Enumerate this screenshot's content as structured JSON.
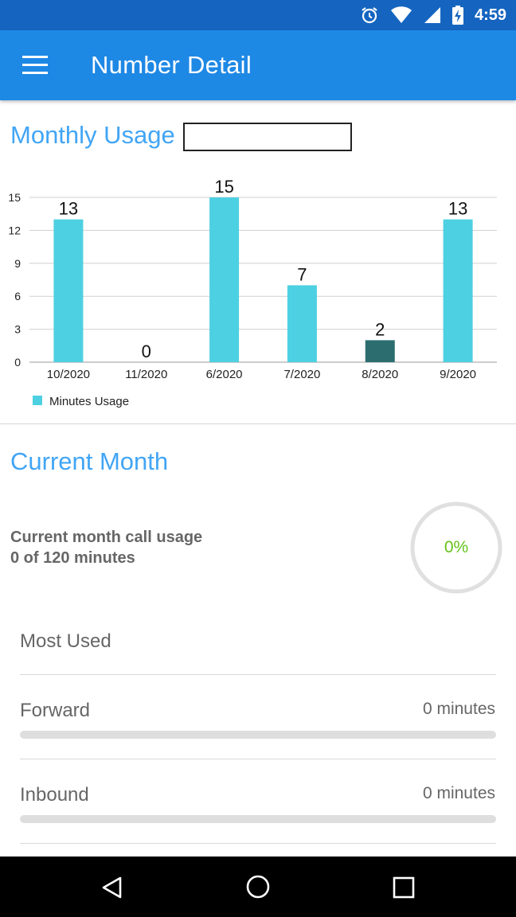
{
  "status_bar": {
    "time": "4:59",
    "icons": [
      "alarm-icon",
      "wifi-icon",
      "cell-signal-icon",
      "battery-charging-icon"
    ]
  },
  "app_bar": {
    "title": "Number Detail",
    "menu_icon": "hamburger-menu-icon"
  },
  "monthly": {
    "title": "Monthly Usage",
    "input_value": ""
  },
  "chart_data": {
    "type": "bar",
    "categories": [
      "10/2020",
      "11/2020",
      "6/2020",
      "7/2020",
      "8/2020",
      "9/2020"
    ],
    "series": [
      {
        "name": "Minutes Usage",
        "values": [
          13,
          0,
          15,
          7,
          2,
          13
        ]
      }
    ],
    "data_labels": [
      "13",
      "0",
      "15",
      "7",
      "2",
      "13"
    ],
    "highlighted_index": 4,
    "yticks": [
      0,
      3,
      6,
      9,
      12,
      15
    ],
    "ylim": [
      0,
      15
    ],
    "grid": true,
    "legend_position": "bottom-left",
    "colors": {
      "bar": "#4dd0e1",
      "highlight": "#2c6e70"
    }
  },
  "current_month": {
    "title": "Current Month",
    "usage_label": "Current month call usage",
    "usage_value": "0 of 120 minutes",
    "percent_text": "0%",
    "percent": 0
  },
  "most_used": {
    "title": "Most Used"
  },
  "usage_rows": [
    {
      "label": "Forward",
      "value": "0 minutes",
      "fraction": 0
    },
    {
      "label": "Inbound",
      "value": "0 minutes",
      "fraction": 0
    }
  ],
  "nav": {
    "back_icon": "back-triangle-icon",
    "home_icon": "home-circle-icon",
    "recents_icon": "recents-square-icon"
  },
  "colors": {
    "app_bar": "#1e88e5",
    "status_bar": "#1565c0",
    "accent_text": "#42a5f5",
    "percent_text": "#66c21a"
  }
}
